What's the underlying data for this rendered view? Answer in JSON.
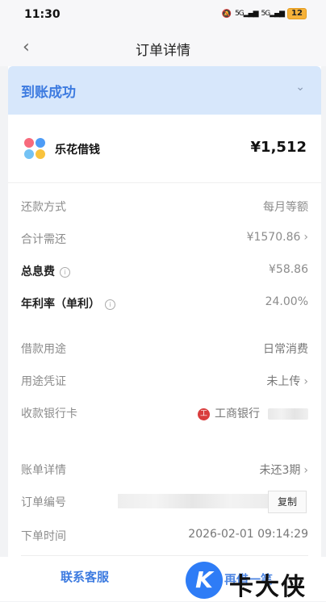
{
  "status_bar": {
    "time": "11:30",
    "signal_left": "5G",
    "signal_right": "5G",
    "battery": "12"
  },
  "nav": {
    "title": "订单详情"
  },
  "status": {
    "text": "到账成功"
  },
  "product": {
    "name": "乐花借钱",
    "amount": "¥1,512"
  },
  "details": [
    {
      "label": "还款方式",
      "value": "每月等额"
    },
    {
      "label": "合计需还",
      "value": "¥1570.86"
    },
    {
      "label": "总息费",
      "value": "¥58.86"
    },
    {
      "label": "年利率（单利）",
      "value": "24.00%"
    }
  ],
  "usage": [
    {
      "label": "借款用途",
      "value": "日常消费"
    },
    {
      "label": "用途凭证",
      "value": "未上传"
    },
    {
      "label": "收款银行卡",
      "value": "工商银行"
    }
  ],
  "bill": [
    {
      "label": "账单详情",
      "value": "未还3期"
    },
    {
      "label": "订单编号",
      "copy_label": "复制"
    },
    {
      "label": "下单时间",
      "value": "2026-02-01 09:14:29"
    }
  ],
  "bottom": {
    "contact_label": "联系客服",
    "partial_label": "再借一笔"
  },
  "watermark": {
    "text": "卡大侠"
  },
  "icons": [
    "back-icon",
    "chevron-down-icon",
    "info-icon",
    "chevron-right-icon",
    "bank-icon",
    "mute-icon"
  ],
  "colors": {
    "accent": "#3d7be0",
    "status_bg": "#d7e7fb"
  }
}
